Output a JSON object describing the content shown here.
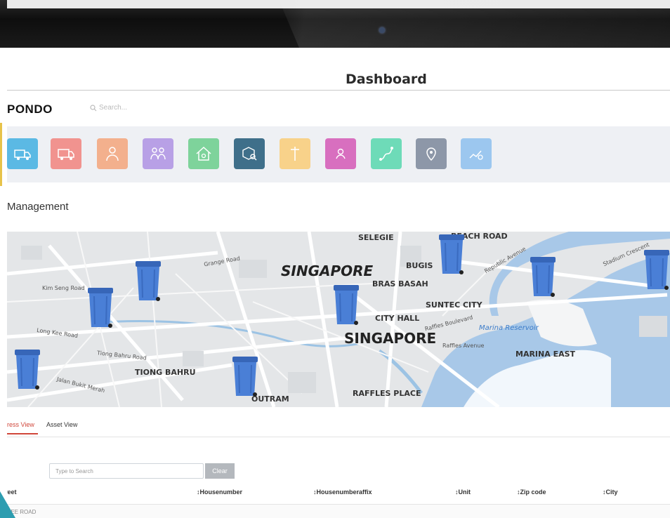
{
  "page": {
    "title": "Dashboard"
  },
  "brand": {
    "name": "PONDO"
  },
  "search": {
    "placeholder": "Search..."
  },
  "toolbar": {
    "tiles": [
      {
        "icon": "truck-cargo-icon",
        "color": "#5bb9e4"
      },
      {
        "icon": "delivery-truck-icon",
        "color": "#f1938f"
      },
      {
        "icon": "worker-icon",
        "color": "#f3b08d"
      },
      {
        "icon": "team-icon",
        "color": "#b8a0e6"
      },
      {
        "icon": "home-icon",
        "color": "#7ed39b"
      },
      {
        "icon": "box-search-icon",
        "color": "#3f6f8a"
      },
      {
        "icon": "pole-icon",
        "color": "#f8d28a"
      },
      {
        "icon": "user-location-icon",
        "color": "#d86fbf"
      },
      {
        "icon": "route-icon",
        "color": "#6edbb8"
      },
      {
        "icon": "map-pin-icon",
        "color": "#8d97a8"
      },
      {
        "icon": "chart-settings-icon",
        "color": "#9cc7ef"
      }
    ]
  },
  "section": {
    "title": "Management"
  },
  "map": {
    "labels": {
      "singapore_top": "SINGAPORE",
      "singapore_center": "SINGAPORE",
      "selegie": "SELEGIE",
      "beach_road": "BEACH ROAD",
      "bugis": "BUGIS",
      "bras_basah": "BRAS BASAH",
      "suntec_city": "SUNTEC CITY",
      "city_hall": "CITY HALL",
      "marina_reservoir": "Marina Reservoir",
      "marina_east": "MARINA EAST",
      "tiong_bahru": "TIONG BAHRU",
      "outram": "OUTRAM",
      "raffles_place": "RAFFLES PLACE",
      "long_kee_road": "Long Kee Road",
      "tiong_bahru_road": "Tiong Bahru Road",
      "jalan_bukit_merah": "Jalan Bukit Merah",
      "kim_seng_road": "Kim Seng Road",
      "grange_road": "Grange Road",
      "raffles_boulevard": "Raffles Boulevard",
      "republic_avenue": "Republic Avenue",
      "stadium_crescent": "Stadium Crescent",
      "raffles_avenue": "Raffles Avenue"
    },
    "bin_color": "#4a7fd6",
    "water_color": "#a8c8e8"
  },
  "tabs": [
    {
      "label": "Address View",
      "active": true
    },
    {
      "label": "Asset View",
      "active": false
    }
  ],
  "table": {
    "search_placeholder": "Type to Search",
    "clear_label": "Clear",
    "columns": [
      "Street",
      "Housenumber",
      "Housenumberaffix",
      "Unit",
      "Zip code",
      "City"
    ],
    "rows": [
      [
        "KEE ROAD"
      ]
    ]
  },
  "colors": {
    "accent": "#d0463a",
    "corner": "#2d9db0",
    "yellow_mark": "#e7c34a"
  }
}
